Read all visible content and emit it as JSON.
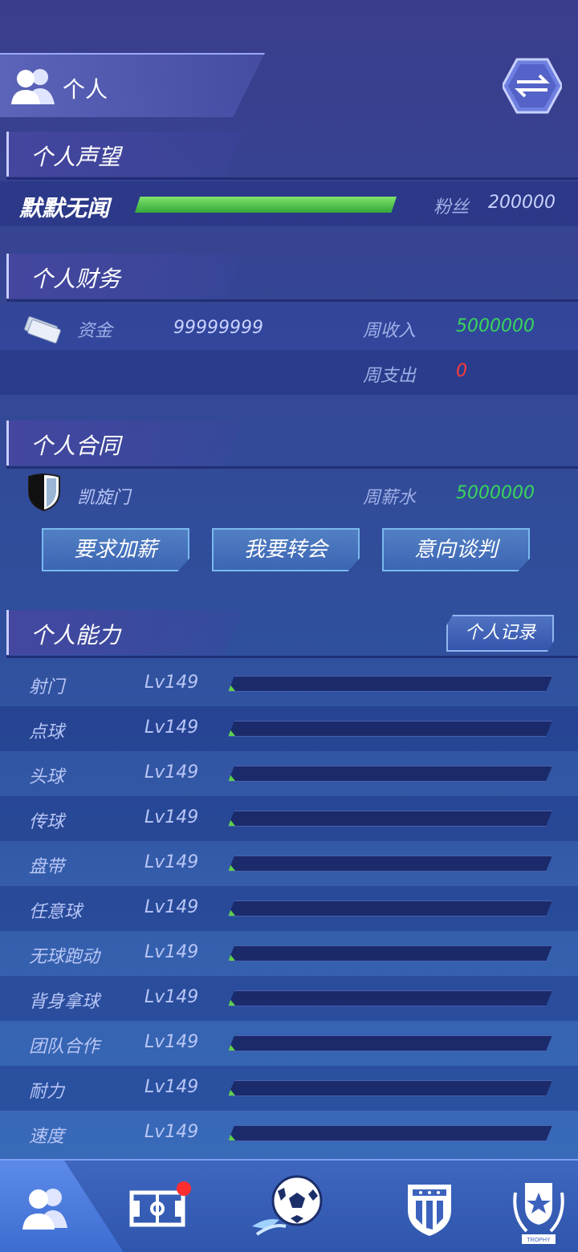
{
  "header": {
    "title": "个人",
    "switch_icon": "swap-arrows-icon"
  },
  "sections": {
    "prestige": "个人声望",
    "finance": "个人财务",
    "contract": "个人合同",
    "ability": "个人能力"
  },
  "prestige": {
    "name": "默默无闻",
    "progress": 1.0,
    "fans_label": "粉丝",
    "fans_value": "200000"
  },
  "finance": {
    "funds_label": "资金",
    "funds_value": "99999999",
    "weekly_income_label": "周收入",
    "weekly_income_value": "5000000",
    "weekly_expense_label": "周支出",
    "weekly_expense_value": "0"
  },
  "contract": {
    "team": "凯旋门",
    "weekly_salary_label": "周薪水",
    "weekly_salary_value": "5000000",
    "buttons": [
      "要求加薪",
      "我要转会",
      "意向谈判"
    ]
  },
  "ability": {
    "record_button": "个人记录",
    "skills": [
      {
        "name": "射门",
        "level": "Lv149",
        "progress": 0.0
      },
      {
        "name": "点球",
        "level": "Lv149",
        "progress": 0.0
      },
      {
        "name": "头球",
        "level": "Lv149",
        "progress": 0.0
      },
      {
        "name": "传球",
        "level": "Lv149",
        "progress": 0.0
      },
      {
        "name": "盘带",
        "level": "Lv149",
        "progress": 0.0
      },
      {
        "name": "任意球",
        "level": "Lv149",
        "progress": 0.0
      },
      {
        "name": "无球跑动",
        "level": "Lv149",
        "progress": 0.0
      },
      {
        "name": "背身拿球",
        "level": "Lv149",
        "progress": 0.0
      },
      {
        "name": "团队合作",
        "level": "Lv149",
        "progress": 0.0
      },
      {
        "name": "耐力",
        "level": "Lv149",
        "progress": 0.0
      },
      {
        "name": "速度",
        "level": "Lv149",
        "progress": 0.0
      }
    ]
  },
  "nav": {
    "items": [
      "players-icon",
      "pitch-icon",
      "soccer-ball-icon",
      "club-crest-icon",
      "trophy-icon"
    ],
    "trophy_text": "TROPHY"
  },
  "colors": {
    "green": "#39d65a",
    "red": "#ff3b3b",
    "accent": "#79b9ee"
  }
}
